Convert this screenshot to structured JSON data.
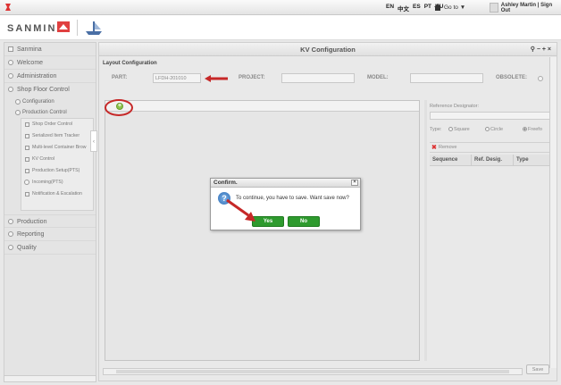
{
  "topbar": {
    "languages": [
      "EN",
      "中文",
      "ES",
      "PT",
      "HU"
    ],
    "goto_label": "Go to ▼",
    "user_label": "Ashley Martin | Sign Out"
  },
  "header": {
    "brand": "SANMINA"
  },
  "sidebar": {
    "items": [
      {
        "label": "Sanmina"
      },
      {
        "label": "Welcome"
      },
      {
        "label": "Administration"
      },
      {
        "label": "Shop Floor Control"
      }
    ],
    "configuration_label": "Configuration",
    "production_control_label": "Production Control",
    "production_children": [
      "Shop Order Control",
      "Serialized Item Tracker",
      "Multi-level Container Brow",
      "KV Control",
      "Production Setup(PTS)",
      "Incoming(PTS)",
      "Notification & Escalation"
    ],
    "bottom_items": [
      {
        "label": "Production"
      },
      {
        "label": "Reporting"
      },
      {
        "label": "Quality"
      }
    ]
  },
  "main": {
    "title": "KV Configuration",
    "window_controls": "⚲ − + ×",
    "section_label": "Layout Configuration",
    "fields": {
      "part_label": "PART:",
      "part_value": "LFDH-201010",
      "project_label": "PROJECT:",
      "model_label": "MODEL:",
      "obsolete_label": "OBSOLETE:"
    },
    "reference": {
      "designator_label": "Reference Designator:",
      "type_label": "Type:",
      "types": [
        "Square",
        "Circle",
        "Freefo"
      ],
      "remove_label": "Remove",
      "columns": [
        "Sequence",
        "Ref. Desig.",
        "Type"
      ]
    },
    "save_label": "Save"
  },
  "dialog": {
    "title": "Confirm.",
    "message": "To continue, you have to save. Want save now?",
    "yes_label": "Yes",
    "no_label": "No"
  },
  "colors": {
    "accent_green": "#2e9a2e",
    "annotation_red": "#c62828"
  }
}
